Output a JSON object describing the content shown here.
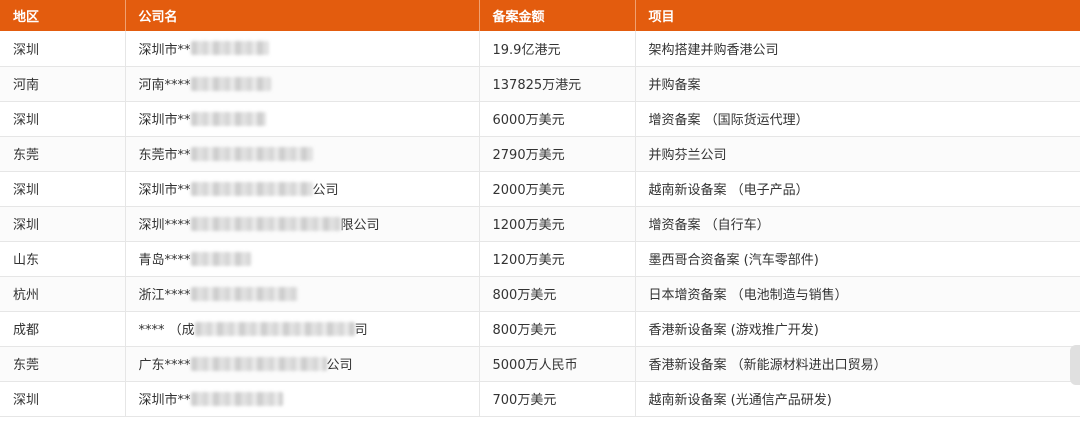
{
  "headers": [
    "地区",
    "公司名",
    "备案金额",
    "项目"
  ],
  "rows": [
    {
      "region": "深圳",
      "company_pre": "深圳市**",
      "company_post": "",
      "amount": "19.9亿港元",
      "project": "架构搭建并购香港公司"
    },
    {
      "region": "河南",
      "company_pre": "河南****",
      "company_post": "",
      "amount": "137825万港元",
      "project": "并购备案"
    },
    {
      "region": "深圳",
      "company_pre": "深圳市**",
      "company_post": "",
      "amount": "6000万美元",
      "project": "增资备案 （国际货运代理）"
    },
    {
      "region": "东莞",
      "company_pre": "东莞市**",
      "company_post": "",
      "amount": "2790万美元",
      "project": "并购芬兰公司"
    },
    {
      "region": "深圳",
      "company_pre": "深圳市**",
      "company_post": "公司",
      "amount": "2000万美元",
      "project": "越南新设备案 （电子产品）"
    },
    {
      "region": "深圳",
      "company_pre": "深圳****",
      "company_post": "限公司",
      "amount": "1200万美元",
      "project": "增资备案 （自行车）"
    },
    {
      "region": "山东",
      "company_pre": "青岛****",
      "company_post": "",
      "amount": "1200万美元",
      "project": "墨西哥合资备案 (汽车零部件)"
    },
    {
      "region": "杭州",
      "company_pre": "浙江****",
      "company_post": "",
      "amount": "800万美元",
      "project": "日本增资备案 （电池制造与销售）"
    },
    {
      "region": "成都",
      "company_pre": "**** （成",
      "company_post": "司",
      "amount": "800万美元",
      "project": "香港新设备案 (游戏推广开发)"
    },
    {
      "region": "东莞",
      "company_pre": "广东****",
      "company_post": "公司",
      "amount": "5000万人民币",
      "project": "香港新设备案 （新能源材料进出口贸易）"
    },
    {
      "region": "深圳",
      "company_pre": "深圳市**",
      "company_post": "",
      "amount": "700万美元",
      "project": "越南新设备案 (光通信产品研发)"
    }
  ]
}
